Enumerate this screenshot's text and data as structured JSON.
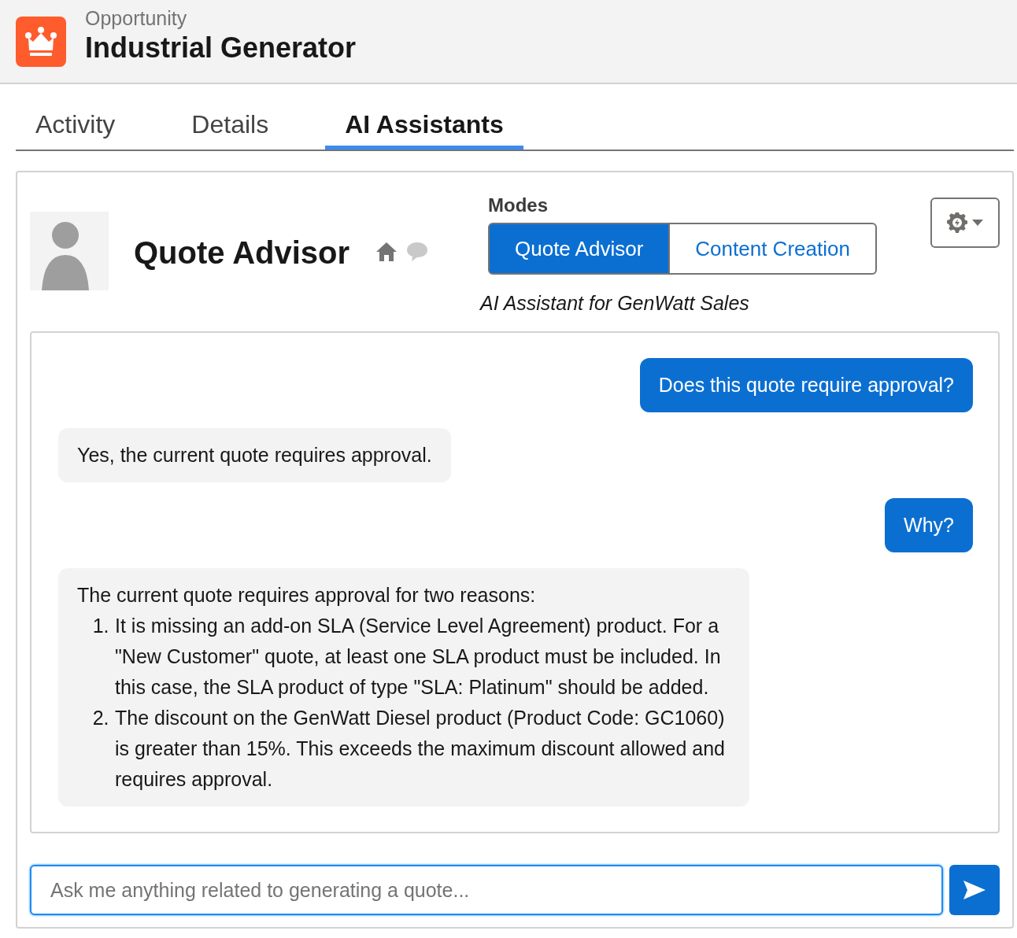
{
  "header": {
    "object_type": "Opportunity",
    "title": "Industrial Generator"
  },
  "tabs": [
    {
      "label": "Activity",
      "selected": false
    },
    {
      "label": "Details",
      "selected": false
    },
    {
      "label": "AI Assistants",
      "selected": true
    }
  ],
  "assistant": {
    "name": "Quote Advisor",
    "modes_label": "Modes",
    "modes": [
      {
        "label": "Quote Advisor",
        "selected": true
      },
      {
        "label": "Content Creation",
        "selected": false
      }
    ],
    "subtitle": "AI Assistant for GenWatt Sales"
  },
  "messages": [
    {
      "kind": "user",
      "text": "Does this quote require approval?"
    },
    {
      "kind": "assistant",
      "text": "Yes, the current quote requires approval."
    },
    {
      "kind": "user",
      "text": "Why?"
    },
    {
      "kind": "assistant",
      "text": "The current quote requires approval for two reasons:",
      "items": [
        {
          "number": "1.",
          "text": "It is missing an add-on SLA (Service Level Agreement) product. For a \"New Customer\" quote, at least one SLA product must be included. In this case, the SLA product of type \"SLA: Platinum\" should be added."
        },
        {
          "number": "2.",
          "text": "The discount on the GenWatt Diesel product (Product Code: GC1060) is greater than 15%. This exceeds the maximum discount allowed and requires approval."
        }
      ]
    }
  ],
  "input": {
    "placeholder": "Ask me anything related to generating a quote..."
  }
}
